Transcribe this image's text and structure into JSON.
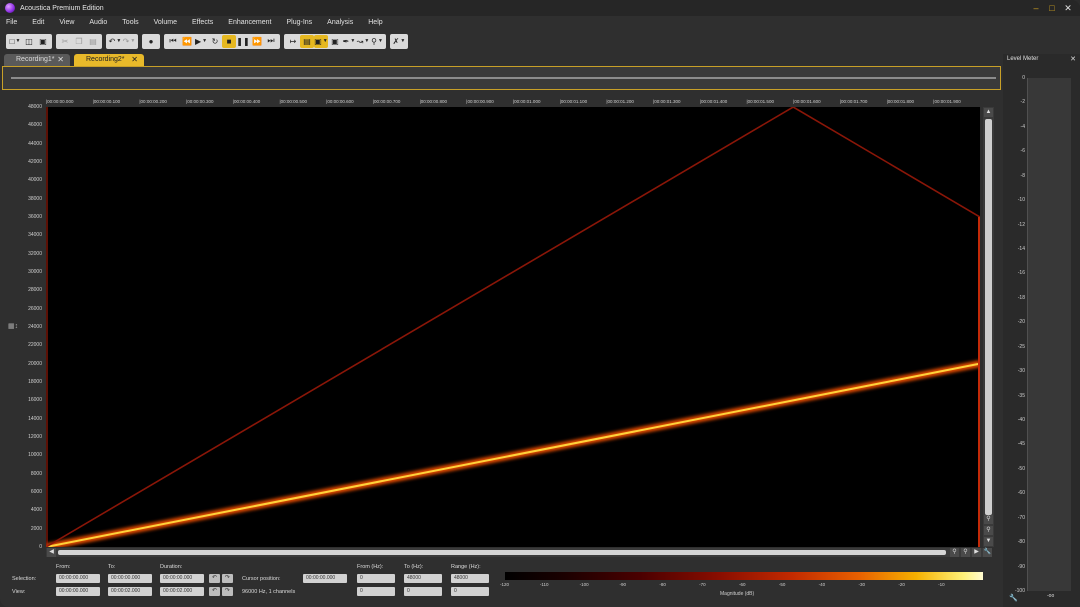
{
  "window": {
    "title": "Acoustica Premium Edition"
  },
  "menu": [
    "File",
    "Edit",
    "View",
    "Audio",
    "Tools",
    "Volume",
    "Effects",
    "Enhancement",
    "Plug-Ins",
    "Analysis",
    "Help"
  ],
  "tabs": [
    {
      "label": "Recording1*",
      "active": false
    },
    {
      "label": "Recording2*",
      "active": true
    }
  ],
  "level_meter": {
    "title": "Level Meter",
    "scale": [
      "0",
      "-2",
      "-4",
      "-6",
      "-8",
      "-10",
      "-12",
      "-14",
      "-16",
      "-18",
      "-20",
      "-25",
      "-30",
      "-35",
      "-40",
      "-45",
      "-50",
      "-60",
      "-70",
      "-80",
      "-90",
      "-100"
    ],
    "footer": "-oo"
  },
  "ruler": {
    "labels": [
      "00:00:00.000",
      "00:00:00.100",
      "00:00:00.200",
      "00:00:00.300",
      "00:00:00.400",
      "00:00:00.500",
      "00:00:00.600",
      "00:00:00.700",
      "00:00:00.800",
      "00:00:00.900",
      "00:00:01.000",
      "00:00:01.100",
      "00:00:01.200",
      "00:00:01.300",
      "00:00:01.400",
      "00:00:01.500",
      "00:00:01.600",
      "00:00:01.700",
      "00:00:01.800",
      "00:00:01.900"
    ]
  },
  "frequency_axis": {
    "labels": [
      "48000",
      "46000",
      "44000",
      "42000",
      "40000",
      "38000",
      "36000",
      "34000",
      "32000",
      "30000",
      "28000",
      "26000",
      "24000",
      "22000",
      "20000",
      "18000",
      "16000",
      "14000",
      "12000",
      "10000",
      "8000",
      "6000",
      "4000",
      "2000",
      "0"
    ]
  },
  "chart_data": {
    "type": "heatmap",
    "x_range": [
      0,
      2.0
    ],
    "x_unit": "s",
    "y_range": [
      0,
      48000
    ],
    "y_unit": "Hz",
    "features": [
      {
        "kind": "sweep",
        "x": [
          0,
          2.0
        ],
        "y": [
          0,
          20000
        ],
        "intensity": "bright"
      },
      {
        "kind": "alias-sweep",
        "x": [
          0,
          1.6,
          2.0
        ],
        "y": [
          0,
          48000,
          36000
        ],
        "intensity": "dim"
      }
    ],
    "colorbar": {
      "title": "Magnitude (dB)",
      "ticks": [
        "-120",
        "-110",
        "-100",
        "-90",
        "-80",
        "-70",
        "-60",
        "-50",
        "-40",
        "-30",
        "-20",
        "-10"
      ]
    }
  },
  "info": {
    "from_label": "From:",
    "to_label": "To:",
    "duration_label": "Duration:",
    "selection_label": "Selection:",
    "view_label": "View:",
    "cursor_label": "Cursor position:",
    "format": "96000 Hz, 1 channels",
    "from_hz_label": "From (Hz):",
    "to_hz_label": "To (Hz):",
    "range_hz_label": "Range (Hz):",
    "selection": {
      "from": "00:00:00.000",
      "to": "00:00:00.000",
      "duration": "00:00:00.000"
    },
    "view": {
      "from": "00:00:00.000",
      "to": "00:00:02.000",
      "duration": "00:00:02.000"
    },
    "cursor": "00:00:00.000",
    "sel_hz": {
      "from": "0",
      "to": "48000",
      "range": "48000"
    },
    "view_hz": {
      "from": "0",
      "to": "0",
      "range": "0"
    }
  },
  "icons": {
    "new": "file-new-icon",
    "open": "folder-open-icon",
    "save": "save-icon",
    "record": "record-icon",
    "play": "play-icon",
    "stop": "stop-icon"
  }
}
